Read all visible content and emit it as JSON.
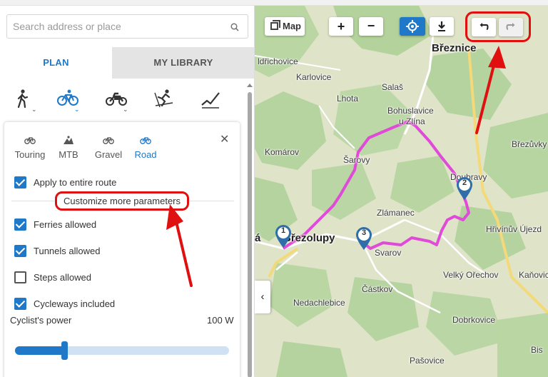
{
  "search": {
    "placeholder": "Search address or place"
  },
  "tabs": [
    {
      "label": "PLAN"
    },
    {
      "label": "MY LIBRARY"
    }
  ],
  "modes": [
    {
      "icon": "hiking-icon"
    },
    {
      "icon": "bike-icon"
    },
    {
      "icon": "motorbike-icon"
    },
    {
      "icon": "ski-icon"
    },
    {
      "icon": "draw-line-icon"
    }
  ],
  "bike_types": [
    {
      "label": "Touring",
      "icon": "touring-bike-icon"
    },
    {
      "label": "MTB",
      "icon": "mtb-bike-icon"
    },
    {
      "label": "Gravel",
      "icon": "gravel-bike-icon"
    },
    {
      "label": "Road",
      "icon": "road-bike-icon",
      "active": true
    }
  ],
  "options": {
    "apply_all": {
      "label": "Apply to entire route",
      "checked": true
    },
    "customize": "Customize more parameters",
    "ferries": {
      "label": "Ferries allowed",
      "checked": true
    },
    "tunnels": {
      "label": "Tunnels allowed",
      "checked": true
    },
    "steps": {
      "label": "Steps allowed",
      "checked": false
    },
    "cycleways": {
      "label": "Cycleways included",
      "checked": true
    }
  },
  "power": {
    "label": "Cyclist's power",
    "value": "100 W",
    "level": 0.23
  },
  "map": {
    "layer_button": "Map",
    "zoom_in": "+",
    "zoom_out": "−",
    "collapse_icon": "chevron-left-icon",
    "places": {
      "breznice": "Březnice",
      "ldrichovice": "ldřichovice",
      "karlovice": "Karlovice",
      "salas": "Salaš",
      "lhota": "Lhota",
      "bohuslavice": "Bohuslavice",
      "uzlina": "u Zlína",
      "komarov": "Komárov",
      "sarovy": "Šarovy",
      "dobravy": "Doubravy",
      "brezuvky": "Březůvky",
      "zlamanec": "Zlámanec",
      "hrivinuv": "Hřivínův Újezd",
      "a": "á",
      "brezolupy": "Březolupy",
      "svarov": "Svarov",
      "velky": "Velký Ořechov",
      "kanovice": "Kaňovice",
      "castkov": "Částkov",
      "nedachlebice": "Nedachlebice",
      "dobrkovice": "Dobrkovice",
      "pasovice": "Pašovice",
      "bis": "Bis"
    },
    "waypoints": [
      "1",
      "2",
      "3"
    ],
    "route_color": "#e04ad8"
  },
  "colors": {
    "accent": "#1f78c8",
    "annotation": "#e01010"
  }
}
